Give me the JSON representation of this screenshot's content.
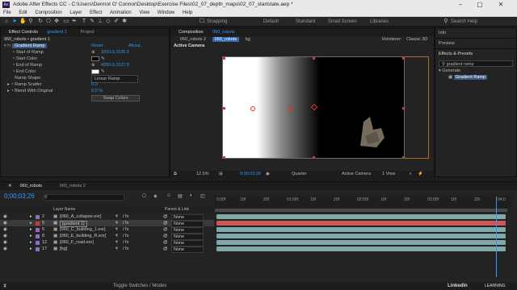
{
  "window": {
    "title": "Adobe After Effects CC - C:\\Users\\Dermot O' Connor\\Desktop\\Exercise Files\\02_07_depth_maps\\02_07_startstate.aep *"
  },
  "menu": [
    "File",
    "Edit",
    "Composition",
    "Layer",
    "Effect",
    "Animation",
    "View",
    "Window",
    "Help"
  ],
  "toolbar": {
    "snapping_label": "Snapping",
    "workspaces": [
      "Default",
      "Standard",
      "Small Screen",
      "Libraries"
    ],
    "search_placeholder": "Search Help"
  },
  "effect_controls": {
    "tab_label": "Effect Controls",
    "tab_target": "gradient 1",
    "project_tab": "Project",
    "header": "060_robots • gradient 1",
    "effect_name": "Gradient Ramp",
    "reset_label": "Reset",
    "about_label": "About...",
    "props": [
      {
        "name": "Start of Ramp",
        "value": "1610.0,1125.0"
      },
      {
        "name": "Start Color",
        "value": ""
      },
      {
        "name": "End of Ramp",
        "value": "4200.0,1127.0"
      },
      {
        "name": "End Color",
        "value": ""
      },
      {
        "name": "Ramp Shape",
        "value": "Linear Ramp"
      },
      {
        "name": "Ramp Scatter",
        "value": "0.0"
      },
      {
        "name": "Blend With Original",
        "value": "0.0 %"
      }
    ],
    "swap_colors_label": "Swap Colors"
  },
  "composition": {
    "tab_label": "Composition",
    "tab_target": "060_robots",
    "breadcrumbs": [
      "060_robots 2",
      "060_robots",
      "bg"
    ],
    "renderer_label": "Renderer:",
    "renderer_value": "Classic 3D",
    "active_camera_label": "Active Camera",
    "footer": {
      "zoom": "12.5%",
      "timecode": "0;00;03;26",
      "resolution": "Quarter",
      "view": "Active Camera",
      "views": "1 View"
    }
  },
  "right_panels": {
    "info": "Info",
    "preview": "Preview",
    "effects_presets": "Effects & Presets",
    "search_value": "gradient ramp",
    "category": "Generate",
    "result": "Gradient Ramp"
  },
  "timeline": {
    "tabs": [
      "060_robots",
      "060_robots 2"
    ],
    "current_time": "0;00;03;26",
    "columns": {
      "layer_name": "Layer Name",
      "parent": "Parent & Link"
    },
    "layers": [
      {
        "num": "2",
        "name": "[060_A_collapse.exr]",
        "parent": "None",
        "color": "#8a6fc0",
        "selected": false
      },
      {
        "num": "5",
        "name": "[gradient 1]",
        "parent": "None",
        "color": "#d23a3a",
        "selected": true
      },
      {
        "num": "6",
        "name": "[060_C_building_1.exr]",
        "parent": "None",
        "color": "#8a6fc0",
        "selected": false
      },
      {
        "num": "8",
        "name": "[060_E_building_R.exr]",
        "parent": "None",
        "color": "#8a6fc0",
        "selected": false
      },
      {
        "num": "12",
        "name": "[060_F_road.exr]",
        "parent": "None",
        "color": "#8a6fc0",
        "selected": false
      },
      {
        "num": "17",
        "name": "[bg]",
        "parent": "None",
        "color": "#8a6fc0",
        "selected": false
      }
    ],
    "ruler_ticks": [
      "0;00f",
      "10f",
      "20f",
      "01;00f",
      "10f",
      "20f",
      "02;00f",
      "10f",
      "20f",
      "03;00f",
      "10f",
      "20f",
      "04;0"
    ],
    "toggle_label": "Toggle Switches / Modes"
  },
  "brand": {
    "name": "LinkedIn",
    "suffix": "LEARNING"
  },
  "colors": {
    "accent": "#2f9bff",
    "selected_layer": "#d23a3a",
    "track": "#7fa6a8",
    "track_selected": "#c95757"
  }
}
